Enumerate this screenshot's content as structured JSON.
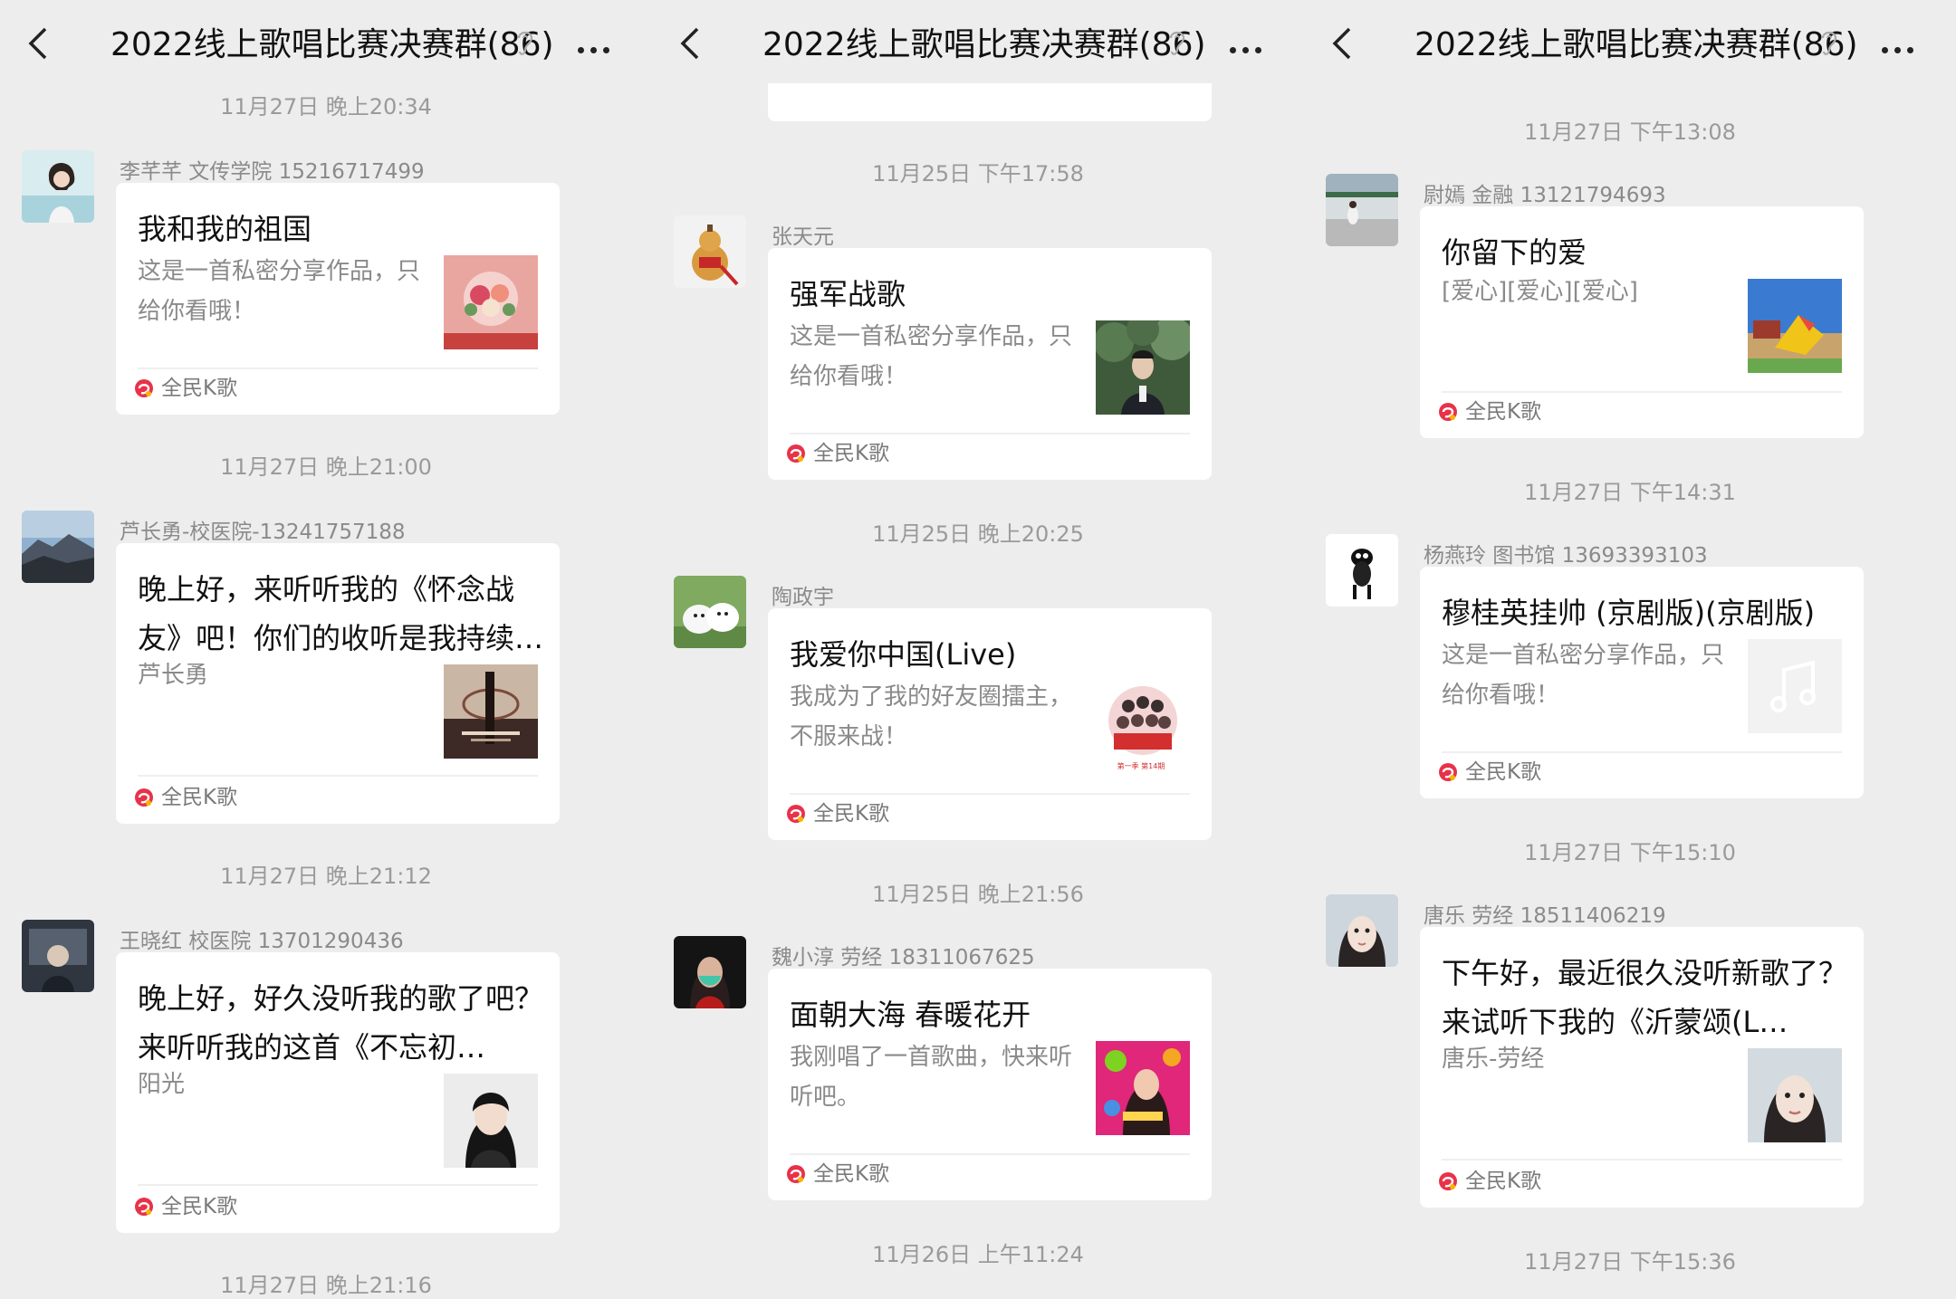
{
  "header": {
    "title": "2022线上歌唱比赛决赛群(86)"
  },
  "source_label": "全民K歌",
  "colors": {
    "background": "#ededed",
    "card": "#ffffff",
    "timestamp": "#9a9a9a",
    "source_icon": "#e8324a"
  },
  "panels": [
    {
      "timestamps": [
        "11月27日 晚上20:34",
        "11月27日 晚上21:00",
        "11月27日 晚上21:12",
        "11月27日 晚上21:16"
      ],
      "messages": [
        {
          "sender": "李芊芊 文传学院 15216717499",
          "title": "我和我的祖国",
          "desc": "这是一首私密分享作品，只给你看哦！",
          "avatar": "woman-portrait",
          "thumb": "flower-art"
        },
        {
          "sender": "芦长勇-校医院-13241757188",
          "title": "晚上好，来听听我的《怀念战友》吧！你们的收听是我持续…",
          "desc": "芦长勇",
          "avatar": "mountain-landscape",
          "thumb": "album-cover"
        },
        {
          "sender": "王晓红 校医院 13701290436",
          "title": "晚上好，好久没听我的歌了吧？来听听我的这首《不忘初…",
          "desc": "阳光",
          "avatar": "dark-photo",
          "thumb": "woman-portrait"
        }
      ]
    },
    {
      "timestamps": [
        "11月25日 下午17:58",
        "11月25日 晚上20:25",
        "11月25日 晚上21:56",
        "11月26日 上午11:24"
      ],
      "messages": [
        {
          "sender": "张天元",
          "title": "强军战歌",
          "desc": "这是一首私密分享作品，只给你看哦！",
          "avatar": "gourd",
          "thumb": "man-in-trees"
        },
        {
          "sender": "陶政宇",
          "title": "我爱你中国(Live)",
          "desc": "我成为了我的好友圈擂主，不服来战！",
          "avatar": "white-dogs",
          "thumb": "group-photo",
          "thumb_caption": "第一季 第14期"
        },
        {
          "sender": "魏小淳 劳经 18311067625",
          "title": "面朝大海 春暖花开",
          "desc": "我刚唱了一首歌曲，快来听听吧。",
          "avatar": "masked-woman",
          "thumb": "pink-album"
        }
      ]
    },
    {
      "timestamps": [
        "11月27日 下午13:08",
        "11月27日 下午14:31",
        "11月27日 下午15:10",
        "11月27日 下午15:36"
      ],
      "messages": [
        {
          "sender": "尉嫣 金融 13121794693",
          "title": "你留下的爱",
          "desc": "[爱心][爱心][爱心]",
          "avatar": "station-photo",
          "thumb": "sculpture"
        },
        {
          "sender": "杨燕玲  图书馆  13693393103",
          "title": "穆桂英挂帅 (京剧版)(京剧版)",
          "desc": "这是一首私密分享作品，只给你看哦！",
          "avatar": "sheep-cartoon",
          "thumb": "music-note"
        },
        {
          "sender": "唐乐 劳经 18511406219",
          "title": "下午好，最近很久没听新歌了？来试听下我的《沂蒙颂(L…",
          "desc": "唐乐-劳经",
          "avatar": "woman-face",
          "thumb": "woman-face"
        }
      ]
    }
  ]
}
